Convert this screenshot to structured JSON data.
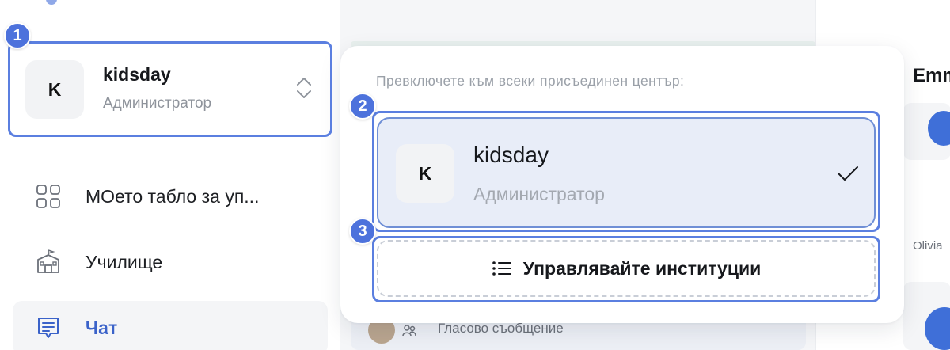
{
  "sidebar": {
    "center": {
      "avatar_letter": "K",
      "name": "kidsday",
      "role": "Администратор"
    },
    "nav": [
      {
        "label": "МОето табло за уп...",
        "icon": "grid-icon",
        "active": false
      },
      {
        "label": "Училище",
        "icon": "school-icon",
        "active": false
      },
      {
        "label": "Чат",
        "icon": "chat-icon",
        "active": true
      }
    ]
  },
  "popover": {
    "heading": "Превключете към всеки присъединен център:",
    "option": {
      "avatar_letter": "K",
      "name": "kidsday",
      "role": "Администратор",
      "selected": true
    },
    "manage_label": "Управлявайте институции"
  },
  "background": {
    "right_name_partial": "Emm",
    "right_label_partial": "Olivia",
    "message_preview": "Гласово съобщение"
  },
  "callouts": [
    "1",
    "2",
    "3"
  ],
  "colors": {
    "accent": "#4d72dc",
    "callout_border": "#5b7fe0",
    "selected_bg": "#e8edf8",
    "active_nav_text": "#3a62c9"
  }
}
